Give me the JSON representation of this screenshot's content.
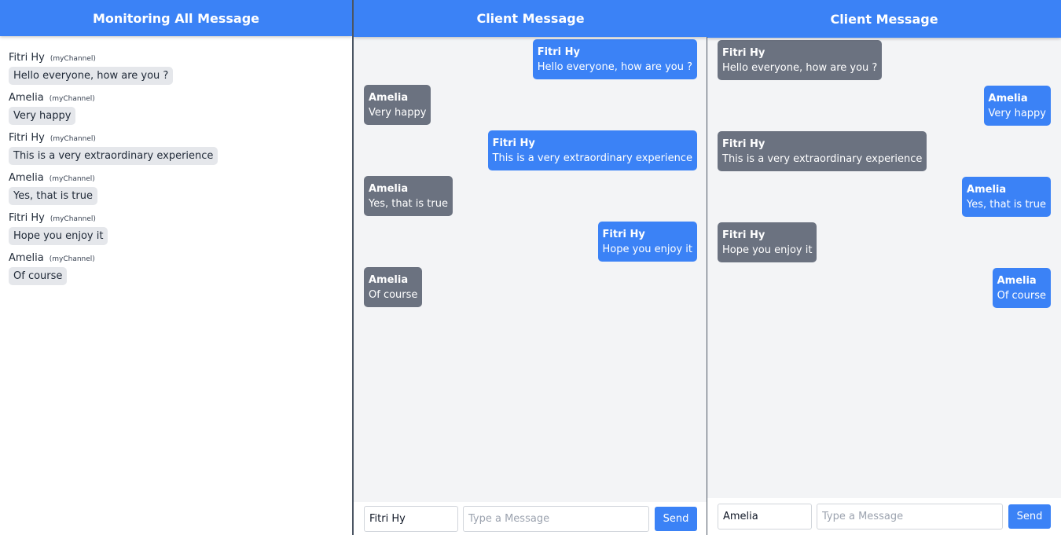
{
  "monitor": {
    "title": "Monitoring All Message",
    "messages": [
      {
        "name": "Fitri Hy",
        "channel": "(myChannel)",
        "text": "Hello everyone, how are you ?"
      },
      {
        "name": "Amelia",
        "channel": "(myChannel)",
        "text": "Very happy"
      },
      {
        "name": "Fitri Hy",
        "channel": "(myChannel)",
        "text": "This is a very extraordinary experience"
      },
      {
        "name": "Amelia",
        "channel": "(myChannel)",
        "text": "Yes, that is true"
      },
      {
        "name": "Fitri Hy",
        "channel": "(myChannel)",
        "text": "Hope you enjoy it"
      },
      {
        "name": "Amelia",
        "channel": "(myChannel)",
        "text": "Of course"
      }
    ]
  },
  "client1": {
    "title": "Client Message",
    "messages": [
      {
        "name": "Fitri Hy",
        "text": "Hello everyone, how are you ?",
        "own": true
      },
      {
        "name": "Amelia",
        "text": "Very happy",
        "own": false
      },
      {
        "name": "Fitri Hy",
        "text": "This is a very extraordinary experience",
        "own": true
      },
      {
        "name": "Amelia",
        "text": "Yes, that is true",
        "own": false
      },
      {
        "name": "Fitri Hy",
        "text": "Hope you enjoy it",
        "own": true
      },
      {
        "name": "Amelia",
        "text": "Of course",
        "own": false
      }
    ],
    "name_value": "Fitri Hy",
    "message_placeholder": "Type a Message",
    "send_label": "Send"
  },
  "client2": {
    "title": "Client Message",
    "messages": [
      {
        "name": "Fitri Hy",
        "text": "Hello everyone, how are you ?",
        "own": false
      },
      {
        "name": "Amelia",
        "text": "Very happy",
        "own": true
      },
      {
        "name": "Fitri Hy",
        "text": "This is a very extraordinary experience",
        "own": false
      },
      {
        "name": "Amelia",
        "text": "Yes, that is true",
        "own": true
      },
      {
        "name": "Fitri Hy",
        "text": "Hope you enjoy it",
        "own": false
      },
      {
        "name": "Amelia",
        "text": "Of course",
        "own": true
      }
    ],
    "name_value": "Amelia",
    "message_placeholder": "Type a Message",
    "send_label": "Send"
  },
  "colors": {
    "header": "#3b82f6",
    "own_bubble": "#3b82f6",
    "other_bubble": "#6b7280",
    "monitor_bubble": "#e5e7eb",
    "client_bg": "#f3f4f6"
  }
}
